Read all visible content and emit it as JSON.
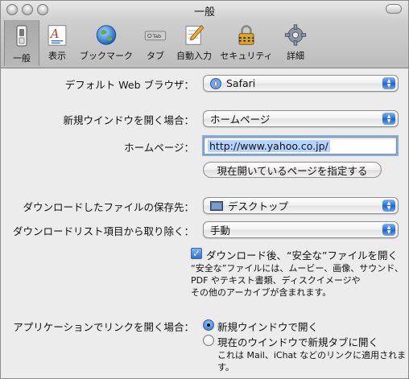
{
  "window": {
    "title": "一般"
  },
  "toolbar": {
    "items": [
      {
        "label": "一般",
        "icon": "switch-icon",
        "selected": true
      },
      {
        "label": "表示",
        "icon": "font-icon",
        "selected": false
      },
      {
        "label": "ブックマーク",
        "icon": "globe-icon",
        "selected": false
      },
      {
        "label": "タブ",
        "icon": "tab-icon",
        "selected": false
      },
      {
        "label": "自動入力",
        "icon": "pencil-form-icon",
        "selected": false
      },
      {
        "label": "セキュリティ",
        "icon": "lock-icon",
        "selected": false
      },
      {
        "label": "詳細",
        "icon": "gear-icon",
        "selected": false
      }
    ]
  },
  "settings": {
    "default_browser": {
      "label": "デフォルト Web ブラウザ：",
      "value": "Safari",
      "icon": "safari-compass-icon"
    },
    "new_window": {
      "label": "新規ウインドウを開く場合：",
      "value": "ホームページ"
    },
    "home_page": {
      "label": "ホームページ：",
      "value": "http://www.yahoo.co.jp/"
    },
    "set_current_button": "現在開いているページを指定する",
    "download_location": {
      "label": "ダウンロードしたファイルの保存先：",
      "value": "デスクトップ",
      "icon": "desktop-folder-icon"
    },
    "remove_download_items": {
      "label": "ダウンロードリスト項目から取り除く：",
      "value": "手動"
    },
    "open_safe_files": {
      "label": "ダウンロード後、“安全な”ファイルを開く",
      "checked": true,
      "note_lines": [
        "“安全な”ファイルには、ムービー、画像、サウンド、",
        "PDF やテキスト書類、ディスクイメージや",
        "その他のアーカイブが含まれます。"
      ]
    },
    "open_links_from_apps": {
      "label": "アプリケーションでリンクを開く場合：",
      "options": [
        {
          "label": "新規ウインドウで開く",
          "selected": true
        },
        {
          "label": "現在のウインドウで新規タブに開く",
          "selected": false
        }
      ],
      "note": "これは Mail、iChat などのリンクに適用されます。"
    }
  },
  "colors": {
    "accent_blue": "#2a6ed9",
    "window_bg": "#ececec",
    "focus_ring": "#7eaef0"
  }
}
